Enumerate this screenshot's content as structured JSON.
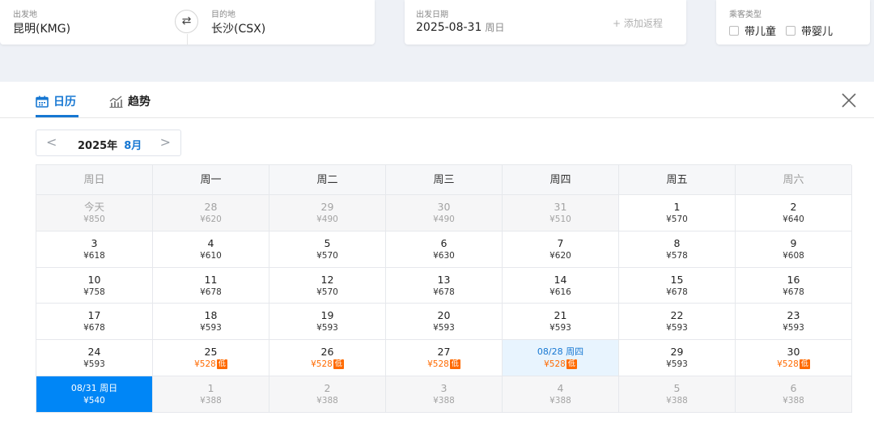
{
  "search": {
    "from_label": "出发地",
    "from_value": "昆明(KMG)",
    "to_label": "目的地",
    "to_value": "长沙(CSX)",
    "swap_glyph": "⇄",
    "date_label": "出发日期",
    "date_value": "2025-08-31",
    "date_weekday": "周日",
    "add_return": "+ 添加返程",
    "pax_label": "乘客类型",
    "pax_child": "带儿童",
    "pax_infant": "带婴儿"
  },
  "panel": {
    "tab_calendar": "日历",
    "tab_trend": "趋势",
    "year_label": "2025年",
    "month_label": "8月",
    "prev_glyph": "<",
    "next_glyph": ">"
  },
  "weekdays": [
    "周日",
    "周一",
    "周二",
    "周三",
    "周四",
    "周五",
    "周六"
  ],
  "low_badge": "低",
  "colors": {
    "accent": "#1677d2",
    "selected": "#0086f6",
    "low_price": "#ff6a00",
    "highlight": "#e8f4fe"
  },
  "weeks": [
    [
      {
        "day": "今天",
        "price": "¥850",
        "state": "disabled"
      },
      {
        "day": "28",
        "price": "¥620",
        "state": "disabled"
      },
      {
        "day": "29",
        "price": "¥490",
        "state": "disabled"
      },
      {
        "day": "30",
        "price": "¥490",
        "state": "disabled"
      },
      {
        "day": "31",
        "price": "¥510",
        "state": "disabled"
      },
      {
        "day": "1",
        "price": "¥570",
        "state": "normal"
      },
      {
        "day": "2",
        "price": "¥640",
        "state": "normal"
      }
    ],
    [
      {
        "day": "3",
        "price": "¥618",
        "state": "normal"
      },
      {
        "day": "4",
        "price": "¥610",
        "state": "normal"
      },
      {
        "day": "5",
        "price": "¥570",
        "state": "normal"
      },
      {
        "day": "6",
        "price": "¥630",
        "state": "normal"
      },
      {
        "day": "7",
        "price": "¥620",
        "state": "normal"
      },
      {
        "day": "8",
        "price": "¥578",
        "state": "normal"
      },
      {
        "day": "9",
        "price": "¥608",
        "state": "normal"
      }
    ],
    [
      {
        "day": "10",
        "price": "¥758",
        "state": "normal"
      },
      {
        "day": "11",
        "price": "¥678",
        "state": "normal"
      },
      {
        "day": "12",
        "price": "¥570",
        "state": "normal"
      },
      {
        "day": "13",
        "price": "¥678",
        "state": "normal"
      },
      {
        "day": "14",
        "price": "¥616",
        "state": "normal"
      },
      {
        "day": "15",
        "price": "¥678",
        "state": "normal"
      },
      {
        "day": "16",
        "price": "¥678",
        "state": "normal"
      }
    ],
    [
      {
        "day": "17",
        "price": "¥678",
        "state": "normal"
      },
      {
        "day": "18",
        "price": "¥593",
        "state": "normal"
      },
      {
        "day": "19",
        "price": "¥593",
        "state": "normal"
      },
      {
        "day": "20",
        "price": "¥593",
        "state": "normal"
      },
      {
        "day": "21",
        "price": "¥593",
        "state": "normal"
      },
      {
        "day": "22",
        "price": "¥593",
        "state": "normal"
      },
      {
        "day": "23",
        "price": "¥593",
        "state": "normal"
      }
    ],
    [
      {
        "day": "24",
        "price": "¥593",
        "state": "normal"
      },
      {
        "day": "25",
        "price": "¥528",
        "state": "low"
      },
      {
        "day": "26",
        "price": "¥528",
        "state": "low"
      },
      {
        "day": "27",
        "price": "¥528",
        "state": "low"
      },
      {
        "day": "08/28 周四",
        "price": "¥528",
        "state": "low-highlight"
      },
      {
        "day": "29",
        "price": "¥593",
        "state": "normal"
      },
      {
        "day": "30",
        "price": "¥528",
        "state": "low"
      }
    ],
    [
      {
        "day": "08/31 周日",
        "price": "¥540",
        "state": "selected"
      },
      {
        "day": "1",
        "price": "¥388",
        "state": "disabled"
      },
      {
        "day": "2",
        "price": "¥388",
        "state": "disabled"
      },
      {
        "day": "3",
        "price": "¥388",
        "state": "disabled"
      },
      {
        "day": "4",
        "price": "¥388",
        "state": "disabled"
      },
      {
        "day": "5",
        "price": "¥388",
        "state": "disabled"
      },
      {
        "day": "6",
        "price": "¥388",
        "state": "disabled"
      }
    ]
  ]
}
